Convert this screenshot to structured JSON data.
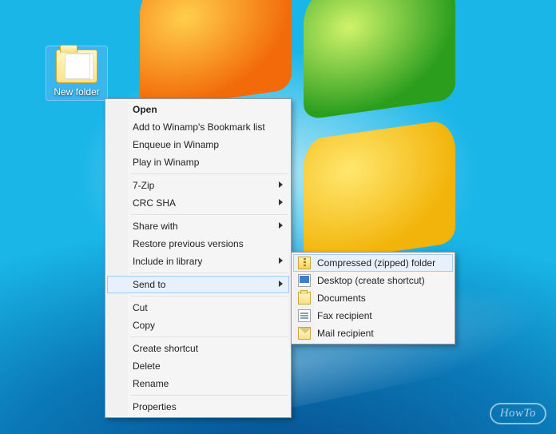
{
  "desktop_icon": {
    "label": "New folder"
  },
  "context_menu": {
    "open": "Open",
    "add_bookmark": "Add to Winamp's Bookmark list",
    "enqueue": "Enqueue in Winamp",
    "play": "Play in Winamp",
    "seven_zip": "7-Zip",
    "crc_sha": "CRC SHA",
    "share_with": "Share with",
    "restore": "Restore previous versions",
    "include_library": "Include in library",
    "send_to": "Send to",
    "cut": "Cut",
    "copy": "Copy",
    "create_shortcut": "Create shortcut",
    "delete": "Delete",
    "rename": "Rename",
    "properties": "Properties"
  },
  "send_to_submenu": {
    "zip": "Compressed (zipped) folder",
    "desktop": "Desktop (create shortcut)",
    "documents": "Documents",
    "fax": "Fax recipient",
    "mail": "Mail recipient"
  },
  "watermark": "HowTo"
}
